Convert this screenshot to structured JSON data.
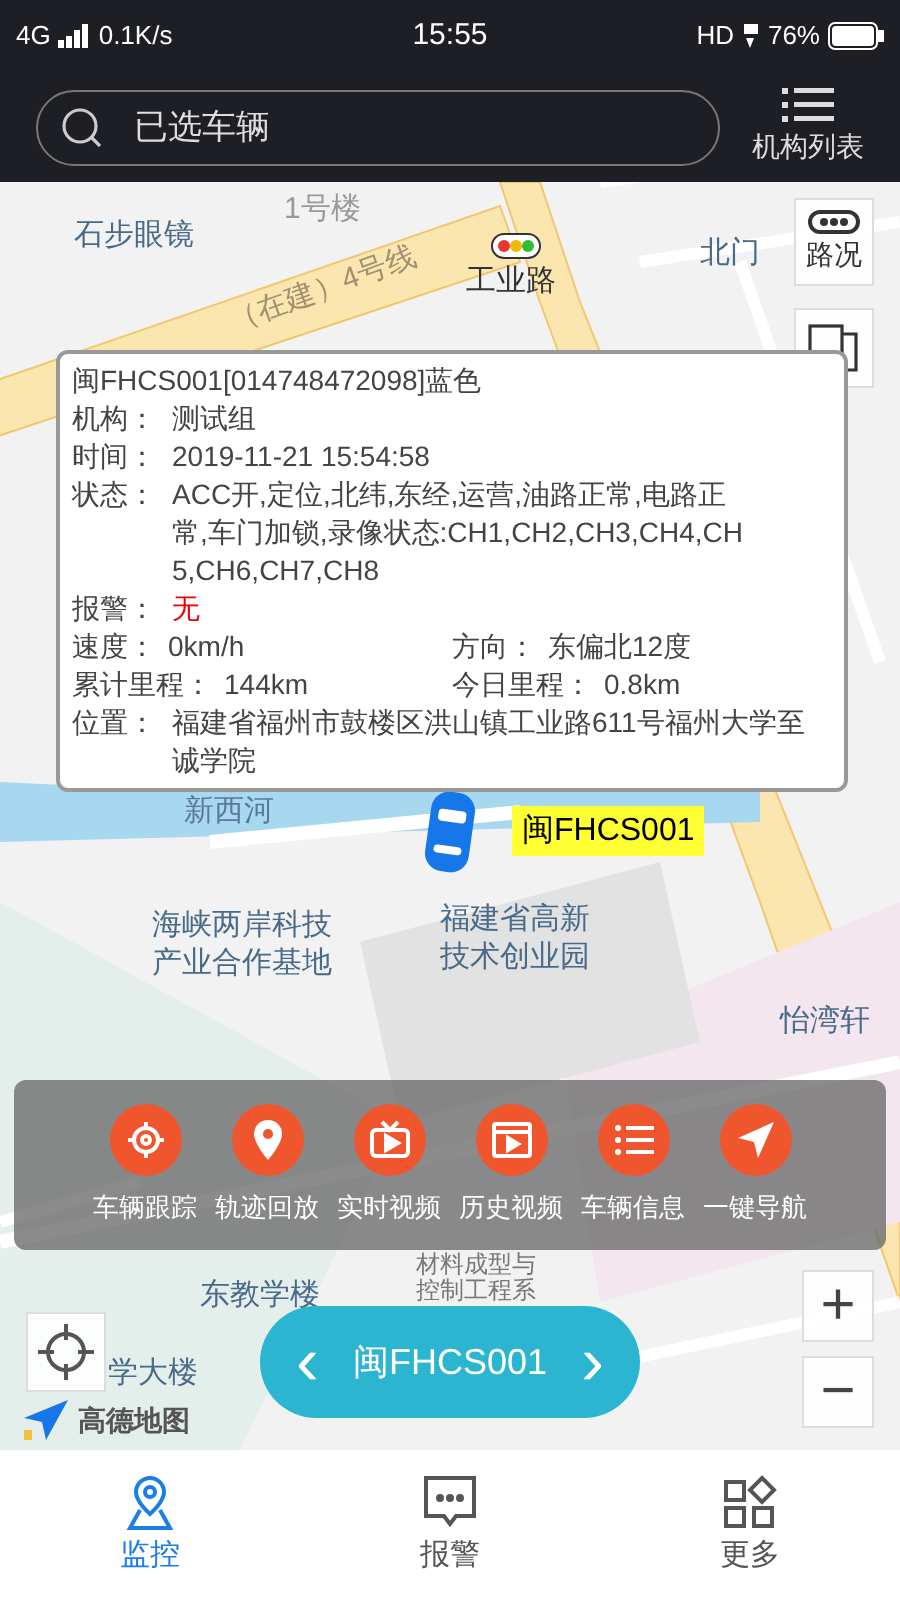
{
  "status_bar": {
    "network": "4G",
    "speed": "0.1K/s",
    "time": "15:55",
    "hd": "HD",
    "battery": "76%"
  },
  "header": {
    "search": {
      "placeholder": "已选车辆"
    },
    "org_list": "机构列表"
  },
  "map": {
    "labels": [
      {
        "text": "1号楼"
      },
      {
        "text": "石步眼镜"
      },
      {
        "text": "（在建）4号线"
      },
      {
        "text": "工业路"
      },
      {
        "text": "北门"
      },
      {
        "text": "新西河"
      },
      {
        "text": "海峡两岸科技产业合作基地"
      },
      {
        "text": "福建省高新技术创业园"
      },
      {
        "text": "怡湾轩"
      },
      {
        "text": "东教学楼"
      },
      {
        "text": "材料成型与控制工程系"
      },
      {
        "text": "学大楼"
      }
    ],
    "traffic": "路况",
    "vehicle_tag": "闽FHCS001",
    "logo": "高德地图",
    "zoom_in": "+",
    "zoom_out": "−"
  },
  "info": {
    "title": "闽FHCS001[014748472098]蓝色",
    "rows": [
      {
        "label": "机构：",
        "value": "测试组",
        "kind": "text"
      },
      {
        "label": "时间：",
        "value": "2019-11-21 15:54:58",
        "kind": "text"
      },
      {
        "label": "状态：",
        "value": "ACC开,定位,北纬,东经,运营,油路正常,电路正常,车门加锁,录像状态:CH1,CH2,CH3,CH4,CH5,CH6,CH7,CH8",
        "kind": "text"
      },
      {
        "label": "报警：",
        "value": "无",
        "kind": "alert"
      }
    ],
    "pairs": [
      [
        {
          "label": "速度：",
          "value": "0km/h"
        },
        {
          "label": "方向：",
          "value": "东偏北12度"
        }
      ],
      [
        {
          "label": "累计里程：",
          "value": "144km"
        },
        {
          "label": "今日里程：",
          "value": "0.8km"
        }
      ]
    ],
    "location": {
      "label": "位置：",
      "value": "福建省福州市鼓楼区洪山镇工业路611号福州大学至诚学院"
    }
  },
  "actions": [
    {
      "label": "车辆跟踪",
      "kind": "track"
    },
    {
      "label": "轨迹回放",
      "kind": "pin"
    },
    {
      "label": "实时视频",
      "kind": "tv"
    },
    {
      "label": "历史视频",
      "kind": "film"
    },
    {
      "label": "车辆信息",
      "kind": "list"
    },
    {
      "label": "一键导航",
      "kind": "nav"
    }
  ],
  "vehicle_switch": {
    "prev": "‹",
    "name": "闽FHCS001",
    "next": "›"
  },
  "tabs": [
    {
      "label": "监控",
      "selected": true,
      "kind": "monitor"
    },
    {
      "label": "报警",
      "selected": false,
      "kind": "alarm"
    },
    {
      "label": "更多",
      "selected": false,
      "kind": "more"
    }
  ]
}
